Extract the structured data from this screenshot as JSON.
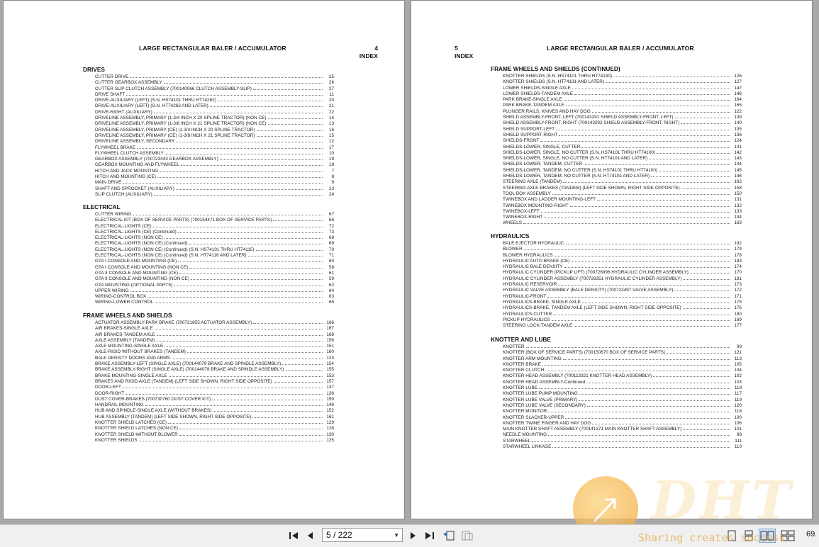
{
  "viewer": {
    "page_indicator": "5 / 222",
    "zoom_text": "69."
  },
  "watermark": {
    "brand": "DHT",
    "slogan": "Sharing creates success"
  },
  "left_page": {
    "title": "LARGE RECTANGULAR BALER / ACCUMULATOR",
    "page_number": "4",
    "page_label": "INDEX",
    "sections": [
      {
        "title": "DRIVES",
        "entries": [
          {
            "t": "CUTTER DRIVE",
            "p": "25"
          },
          {
            "t": "CUTTER GEARBOX ASSEMBLY",
            "p": "26"
          },
          {
            "t": "CUTTER SLIP CLUTCH ASSEMBLY (700140066 CLUTCH ASSEMBLY-SLIP)",
            "p": "27"
          },
          {
            "t": "DRIVE SHAFT",
            "p": "11"
          },
          {
            "t": "DRIVE-AUXILIARY (LEFT) (S.N. HS74101 THRU HT74262)",
            "p": "20"
          },
          {
            "t": "DRIVE-AUXILIARY (LEFT) (S.N. HT74263 AND LATER)",
            "p": "21"
          },
          {
            "t": "DRIVE-RIGHT (AUXILIARY)",
            "p": "22"
          },
          {
            "t": "DRIVELINE ASSEMBLY, PRIMARY (1-3/4 INCH X 20 SPLINE TRACTOR) (NON CE)",
            "p": "14"
          },
          {
            "t": "DRIVELINE ASSEMBLY, PRIMARY (1-3/8 INCH X 21 SPLINE TRACTOR) (NON CE)",
            "p": "13"
          },
          {
            "t": "DRIVELINE ASSEMBLY, PRIMARY (CE) (1-3/4 INCH X 20 SPLINE TRACTOR)",
            "p": "16"
          },
          {
            "t": "DRIVELINE ASSEMBLY, PRIMARY (CE) (1-3/8 INCH X 21 SPLINE TRACTOR)",
            "p": "15"
          },
          {
            "t": "DRIVELINE ASSEMBLY, SECONDARY",
            "p": "12"
          },
          {
            "t": "FLYWHEEL BRAKE",
            "p": "17"
          },
          {
            "t": "FLYWHEEL CLUTCH ASSEMBLY",
            "p": "10"
          },
          {
            "t": "GEARBOX ASSEMBLY (700723443 GEARBOX ASSEMBLY)",
            "p": "19"
          },
          {
            "t": "GEARBOX MOUNTING AND FLYWHEEL",
            "p": "18"
          },
          {
            "t": "HITCH AND JACK MOUNTING",
            "p": "7"
          },
          {
            "t": "HITCH AND MOUNTING (CE)",
            "p": "8"
          },
          {
            "t": "MAIN DRIVE",
            "p": "9"
          },
          {
            "t": "SHAFT AND SPROCKET (AUXILIARY)",
            "p": "23"
          },
          {
            "t": "SLIP CLUTCH (AUXILIARY)",
            "p": "24"
          }
        ]
      },
      {
        "title": "ELECTRICAL",
        "entries": [
          {
            "t": "CUTTER WIRING",
            "p": "67"
          },
          {
            "t": "ELECTRICAL KIT (BOX OF SERVICE PARTS) (700154471 BOX OF SERVICE PARTS)",
            "p": "66"
          },
          {
            "t": "ELECTRICAL-LIGHTS (CE)",
            "p": "72"
          },
          {
            "t": "ELECTRICAL-LIGHTS (CE) (Continued)",
            "p": "73"
          },
          {
            "t": "ELECTRICAL-LIGHTS (NON CE)",
            "p": "68"
          },
          {
            "t": "ELECTRICAL-LIGHTS (NON CE) (Continued)",
            "p": "69"
          },
          {
            "t": "ELECTRICAL-LIGHTS (NON CE) (Continued) (S.N. HS74101 THRU HT74115)",
            "p": "70"
          },
          {
            "t": "ELECTRICAL-LIGHTS (NON CE) (Continued) (S.N. HT74116 AND LATER)",
            "p": "71"
          },
          {
            "t": "GTA I CONSOLE AND MOUNTING (CE)",
            "p": "60"
          },
          {
            "t": "GTA I CONSOLE AND MOUNTING (NON CE)",
            "p": "58"
          },
          {
            "t": "GTA II CONSOLE AND MOUNTING (CE)",
            "p": "61"
          },
          {
            "t": "GTA II CONSOLE AND MOUNTING (NON CE)",
            "p": "59"
          },
          {
            "t": "GTA MOUNTING (OPTIONAL PARTS)",
            "p": "62"
          },
          {
            "t": "UPPER WIRING",
            "p": "64"
          },
          {
            "t": "WIRING-CONTROL BOX",
            "p": "63"
          },
          {
            "t": "WIRING-LOWER CONTROL",
            "p": "65"
          }
        ]
      },
      {
        "title": "FRAME WHEELS AND SHIELDS",
        "entries": [
          {
            "t": "ACTUATOR ASSEMBLY-PARK BRAKE (700721855 ACTUATOR ASSEMBLY)",
            "p": "166"
          },
          {
            "t": "AIR BRAKES-SINGLE AXLE",
            "p": "167"
          },
          {
            "t": "AIR BRAKES-TANDEM AXLE",
            "p": "168"
          },
          {
            "t": "AXLE ASSEMBLY (TANDEM)",
            "p": "156"
          },
          {
            "t": "AXLE MOUNTING-SINGLE AXLE",
            "p": "151"
          },
          {
            "t": "AXLE-RIGID WITHOUT BRAKES (TANDEM)",
            "p": "160"
          },
          {
            "t": "BALE DENSITY DOORS AND ARMS",
            "p": "123"
          },
          {
            "t": "BRAKE ASSEMBLY-LEFT (SINGLE AXLE) (700144079 BRAKE AND SPINDLE ASSEMBLY)",
            "p": "154"
          },
          {
            "t": "BRAKE ASSEMBLY-RIGHT (SINGLE AXLE) (700144078 BRAKE AND SPINDLE ASSEMBLY)",
            "p": "155"
          },
          {
            "t": "BRAKE MOUNTING-SINGLE AXLE",
            "p": "153"
          },
          {
            "t": "BRAKES AND RIGID AXLE (TANDEM) (LEFT SIDE SHOWN, RIGHT SIDE OPPOSITE)",
            "p": "157"
          },
          {
            "t": "DOOR-LEFT",
            "p": "137"
          },
          {
            "t": "DOOR-RIGHT",
            "p": "138"
          },
          {
            "t": "DUST COVER-BRAKES (700730760 DUST COVER KIT)",
            "p": "159"
          },
          {
            "t": "HANDRAIL MOUNTING",
            "p": "149"
          },
          {
            "t": "HUB AND SPINDLE-SINGLE AXLE (WITHOUT BRAKES)",
            "p": "152"
          },
          {
            "t": "HUB ASSEMBLY (TANDEM) (LEFT SIDE SHOWN, RIGHT SIDE OPPOSITE)",
            "p": "161"
          },
          {
            "t": "KNOTTER SHIELD LATCHES (CE)",
            "p": "129"
          },
          {
            "t": "KNOTTER SHIELD LATCHES (NON CE)",
            "p": "128"
          },
          {
            "t": "KNOTTER SHIELD-WITHOUT BLOWER",
            "p": "130"
          },
          {
            "t": "KNOTTER SHIELDS",
            "p": "125"
          }
        ]
      }
    ]
  },
  "right_page": {
    "title": "LARGE RECTANGULAR BALER / ACCUMULATOR",
    "page_number": "5",
    "page_label": "INDEX",
    "sections": [
      {
        "title": "FRAME WHEELS AND SHIELDS (CONTINUED)",
        "entries": [
          {
            "t": "KNOTTER SHIELDS (S.N. HS74101 THRU HT74130)",
            "p": "126"
          },
          {
            "t": "KNOTTER SHIELDS (S.N. HT74131 AND LATER)",
            "p": "127"
          },
          {
            "t": "LOWER SHIELDS-SINGLE AXLE",
            "p": "147"
          },
          {
            "t": "LOWER SHIELDS-TANDEM AXLE",
            "p": "148"
          },
          {
            "t": "PARK BRAKE-SINGLE AXLE",
            "p": "164"
          },
          {
            "t": "PARK BRAKE-TANDEM AXLE",
            "p": "165"
          },
          {
            "t": "PLUNGER RAILS, KNIVES AND HAY DOG",
            "p": "122"
          },
          {
            "t": "SHIELD ASSEMBLY-FRONT, LEFT (700143291 SHIELD ASSEMBLY-FRONT, LEFT)",
            "p": "139"
          },
          {
            "t": "SHIELD ASSEMBLY-FRONT, RIGHT (700143292 SHIELD ASSEMBLY-FRONT, RIGHT)",
            "p": "140"
          },
          {
            "t": "SHIELD SUPPORT-LEFT",
            "p": "135"
          },
          {
            "t": "SHIELD SUPPORT-RIGHT",
            "p": "136"
          },
          {
            "t": "SHIELDS-FRONT",
            "p": "124"
          },
          {
            "t": "SHIELDS-LOWER, SINGLE, CUTTER",
            "p": "141"
          },
          {
            "t": "SHIELDS-LOWER, SINGLE, NO CUTTER (S.N. HS74101 THRU HT74100)",
            "p": "142"
          },
          {
            "t": "SHIELDS-LOWER, SINGLE, NO CUTTER (S.N. HT74101 AND LATER)",
            "p": "143"
          },
          {
            "t": "SHIELDS-LOWER, TANDEM, CUTTER",
            "p": "144"
          },
          {
            "t": "SHIELDS-LOWER, TANDEM, NO CUTTER (S.N. HS74101 THRU HT74100)",
            "p": "145"
          },
          {
            "t": "SHIELDS-LOWER, TANDEM, NO CUTTER (S.N. HT74101 AND LATER)",
            "p": "146"
          },
          {
            "t": "STEERING AXLE (TANDEM)",
            "p": "162"
          },
          {
            "t": "STEERING AXLE BRAKES (TANDEM) (LEFT SIDE SHOWN, RIGHT SIDE OPPOSITE)",
            "p": "158"
          },
          {
            "t": "TOOL BOX ASSEMBLY",
            "p": "150"
          },
          {
            "t": "TWINEBOX AND LADDER MOUNTING-LEFT",
            "p": "131"
          },
          {
            "t": "TWINEBOX MOUNTING-RIGHT",
            "p": "132"
          },
          {
            "t": "TWINEBOX-LEFT",
            "p": "133"
          },
          {
            "t": "TWINEBOX-RIGHT",
            "p": "134"
          },
          {
            "t": "WHEELS",
            "p": "163"
          }
        ]
      },
      {
        "title": "HYDRAULICS",
        "entries": [
          {
            "t": "BALE EJECTOR HYDRAULIC",
            "p": "182"
          },
          {
            "t": "BLOWER",
            "p": "179"
          },
          {
            "t": "BLOWER HYDRAULICS",
            "p": "178"
          },
          {
            "t": "HYDRAULIC AUTO BRAKE (CE)",
            "p": "183"
          },
          {
            "t": "HYDRAULIC BALE DENSITY",
            "p": "174"
          },
          {
            "t": "HYDRAULIC CYLINDER (PICKUP LIFT) (700726996 HYDRAULIC CYLINDER ASSEMBLY)",
            "p": "170"
          },
          {
            "t": "HYDRAULIC CYLINDER ASSEMBLY (700728351 HYDRAULIC CYLINDER ASSEMBLY)",
            "p": "181"
          },
          {
            "t": "HYDRAULIC RESERVOIR",
            "p": "173"
          },
          {
            "t": "HYDRAULIC VALVE ASSEMBLY (BALE DENSITY) (700723497 VALVE ASSEMBLY)",
            "p": "172"
          },
          {
            "t": "HYDRAULIC-FRONT",
            "p": "171"
          },
          {
            "t": "HYDRAULICS-BRAKE, SINGLE AXLE",
            "p": "175"
          },
          {
            "t": "HYDRAULICS-BRAKE, TANDEM AXLE (LEFT SIDE SHOWN, RIGHT SIDE OPPOSITE)",
            "p": "176"
          },
          {
            "t": "HYDRAULICS-CUTTER",
            "p": "180"
          },
          {
            "t": "PICKUP HYDRAULICS",
            "p": "169"
          },
          {
            "t": "STEERING LOCK-TANDEM AXLE",
            "p": "177"
          }
        ]
      },
      {
        "title": "KNOTTER AND LUBE",
        "entries": [
          {
            "t": "KNOTTER",
            "p": "99"
          },
          {
            "t": "KNOTTER (BOX OF SERVICE PARTS) (700150670 BOX OF SERVICE PARTS)",
            "p": "121"
          },
          {
            "t": "KNOTTER ARM MOUNTING",
            "p": "113"
          },
          {
            "t": "KNOTTER BRAKE",
            "p": "105"
          },
          {
            "t": "KNOTTER CLUTCH",
            "p": "104"
          },
          {
            "t": "KNOTTER HEAD ASSEMBLY (700113321 KNOTTER HEAD ASSEMBLY)",
            "p": "102"
          },
          {
            "t": "KNOTTER HEAD ASSEMBLY-Continued",
            "p": "103"
          },
          {
            "t": "KNOTTER LUBE",
            "p": "118"
          },
          {
            "t": "KNOTTER LUBE PUMP MOUNTING",
            "p": "117"
          },
          {
            "t": "KNOTTER LUBE VALVE (PRIMARY)",
            "p": "119"
          },
          {
            "t": "KNOTTER LUBE VALVE (SECONDARY)",
            "p": "120"
          },
          {
            "t": "KNOTTER MONITOR",
            "p": "116"
          },
          {
            "t": "KNOTTER SLACKER-UPPER",
            "p": "100"
          },
          {
            "t": "KNOTTER TWINE FINGER AND HAY DOG",
            "p": "106"
          },
          {
            "t": "MAIN KNOTTER SHAFT ASSEMBLY (700141371 MAIN KNOTTER SHAFT ASSEMBLY)",
            "p": "101"
          },
          {
            "t": "NEEDLE MOUNTING",
            "p": "98"
          },
          {
            "t": "STARWHEEL",
            "p": "111"
          },
          {
            "t": "STARWHEEL LINKAGE",
            "p": "110"
          }
        ]
      }
    ]
  }
}
